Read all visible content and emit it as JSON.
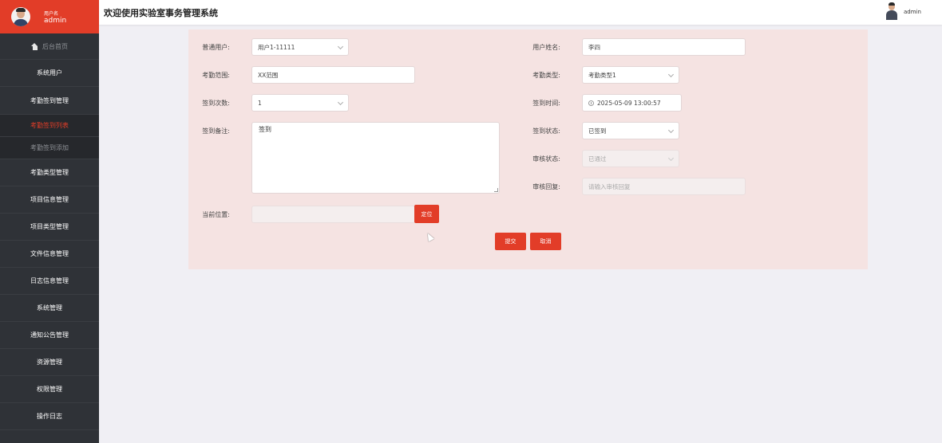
{
  "sidebar": {
    "user_label": "用户名",
    "user_name": "admin",
    "home": "后台首页",
    "items": [
      {
        "label": "系统用户"
      },
      {
        "label": "考勤签到管理"
      },
      {
        "label": "考勤签到列表"
      },
      {
        "label": "考勤签到添加"
      },
      {
        "label": "考勤类型管理"
      },
      {
        "label": "项目信息管理"
      },
      {
        "label": "项目类型管理"
      },
      {
        "label": "文件信息管理"
      },
      {
        "label": "日志信息管理"
      },
      {
        "label": "系统管理"
      },
      {
        "label": "通知公告管理"
      },
      {
        "label": "资源管理"
      },
      {
        "label": "权限管理"
      },
      {
        "label": "操作日志"
      }
    ]
  },
  "header": {
    "title": "欢迎使用实验室事务管理系统",
    "user": "admin"
  },
  "form": {
    "user": {
      "label": "普通用户:",
      "value": "用户1-11111"
    },
    "user_name": {
      "label": "用户姓名:",
      "value": "李四"
    },
    "range": {
      "label": "考勤范围:",
      "value": "XX范围"
    },
    "type": {
      "label": "考勤类型:",
      "value": "考勤类型1"
    },
    "count": {
      "label": "签到次数:",
      "value": "1"
    },
    "time": {
      "label": "签到时间:",
      "value": "2025-05-09 13:00:57"
    },
    "remark": {
      "label": "签到备注:",
      "value": "签到"
    },
    "status": {
      "label": "签到状态:",
      "value": "已签到"
    },
    "review_status": {
      "label": "审核状态:",
      "value": "已通过"
    },
    "review_reply": {
      "label": "审核回复:",
      "placeholder": "请输入审核回复"
    },
    "location": {
      "label": "当前位置:",
      "value": "",
      "locate_button": "定位"
    },
    "submit": "提交",
    "cancel": "取消"
  }
}
